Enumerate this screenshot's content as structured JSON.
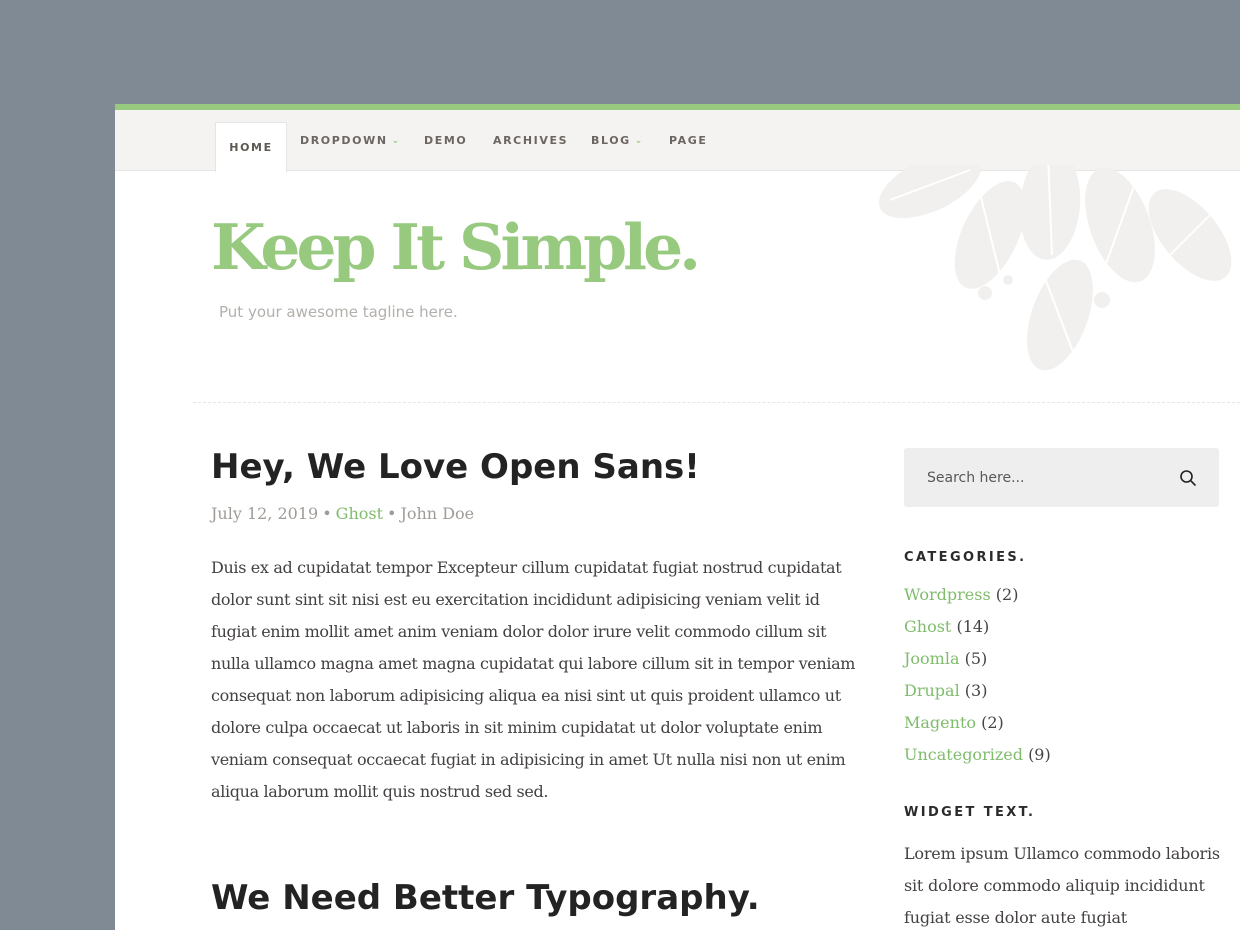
{
  "colors": {
    "accent": "#97c97f",
    "link": "#7fbc6b",
    "backdrop": "#808a94",
    "nav_background": "#f4f3f2"
  },
  "nav": {
    "items": [
      {
        "label": "HOME",
        "active": true
      },
      {
        "label": "DROPDOWN",
        "has_submenu": true,
        "icon": "chevron-down-icon"
      },
      {
        "label": "DEMO"
      },
      {
        "label": "ARCHIVES"
      },
      {
        "label": "BLOG",
        "has_submenu": true,
        "icon": "chevron-down-icon"
      },
      {
        "label": "PAGE"
      }
    ]
  },
  "header": {
    "title": "Keep It Simple.",
    "tagline": "Put your awesome tagline here."
  },
  "posts": [
    {
      "title": "Hey, We Love Open Sans!",
      "date": "July 12, 2019",
      "category": "Ghost",
      "author": "John Doe",
      "excerpt": "Duis ex ad cupidatat tempor Excepteur cillum cupidatat fugiat nostrud cupidatat dolor sunt sint sit nisi est eu exercitation incididunt adipisicing veniam velit id fugiat enim mollit amet anim veniam dolor dolor irure velit commodo cillum sit nulla ullamco magna amet magna cupidatat qui labore cillum sit in tempor veniam consequat non laborum adipisicing aliqua ea nisi sint ut quis proident ullamco ut dolore culpa occaecat ut laboris in sit minim cupidatat ut dolor voluptate enim veniam consequat occaecat fugiat in adipisicing in amet Ut nulla nisi non ut enim aliqua laborum mollit quis nostrud sed sed."
    },
    {
      "title": "We Need Better Typography."
    }
  ],
  "sidebar": {
    "search": {
      "placeholder": "Search here...",
      "icon": "search-icon"
    },
    "categories": {
      "title": "CATEGORIES.",
      "items": [
        {
          "name": "Wordpress",
          "count": "(2)"
        },
        {
          "name": "Ghost",
          "count": "(14)"
        },
        {
          "name": "Joomla",
          "count": "(5)"
        },
        {
          "name": "Drupal",
          "count": "(3)"
        },
        {
          "name": "Magento",
          "count": "(2)"
        },
        {
          "name": "Uncategorized",
          "count": "(9)"
        }
      ]
    },
    "widget_text": {
      "title": "WIDGET TEXT.",
      "body": "Lorem ipsum Ullamco commodo laboris sit dolore commodo aliquip incididunt fugiat esse dolor aute fugiat"
    }
  }
}
